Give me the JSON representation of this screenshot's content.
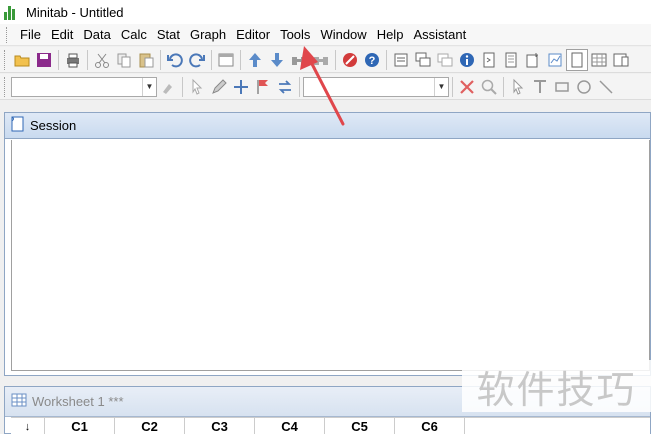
{
  "window": {
    "title": "Minitab - Untitled"
  },
  "menu": [
    {
      "label": "File"
    },
    {
      "label": "Edit"
    },
    {
      "label": "Data"
    },
    {
      "label": "Calc"
    },
    {
      "label": "Stat"
    },
    {
      "label": "Graph"
    },
    {
      "label": "Editor"
    },
    {
      "label": "Tools"
    },
    {
      "label": "Window"
    },
    {
      "label": "Help"
    },
    {
      "label": "Assistant"
    }
  ],
  "session": {
    "title": "Session"
  },
  "worksheet": {
    "title": "Worksheet 1 ***",
    "columns": [
      "C1",
      "C2",
      "C3",
      "C4",
      "C5",
      "C6"
    ],
    "row_marker": "↓"
  },
  "watermark": {
    "text": "软件技巧"
  },
  "colors": {
    "annotation_arrow": "#e0474c",
    "app_icon": "#3a9a3a",
    "accent": "#8fa6c4"
  }
}
